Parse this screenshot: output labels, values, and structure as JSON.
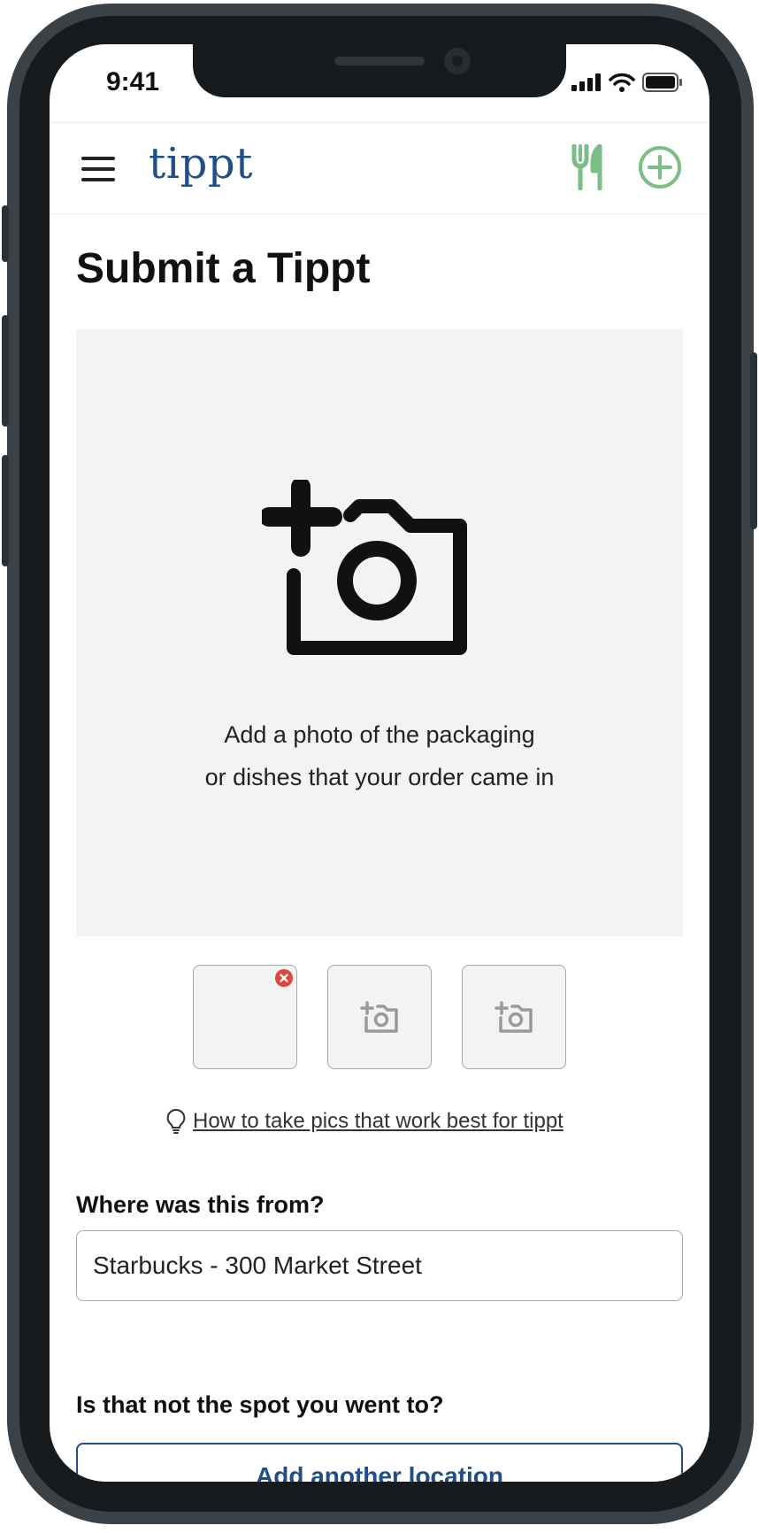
{
  "status_bar": {
    "time": "9:41"
  },
  "header": {
    "brand": "tippt",
    "icons": {
      "menu": "hamburger-menu-icon",
      "utensils": "fork-knife-icon",
      "add": "plus-circle-icon"
    },
    "accent_color": "#7bbf86"
  },
  "main": {
    "title": "Submit a Tippt",
    "upload": {
      "line1": "Add a photo of the packaging",
      "line2": "or dishes that your order came in"
    },
    "tip_link": "How to take pics that work best for tippt",
    "location_label": "Where was this from?",
    "location_value": "Starbucks - 300 Market Street",
    "question": "Is that not the spot you went to?",
    "add_location_label": "Add another location"
  },
  "colors": {
    "brand_blue": "#1f4e8a",
    "remove_red": "#e2463b",
    "upload_bg": "#f3f3f3"
  }
}
